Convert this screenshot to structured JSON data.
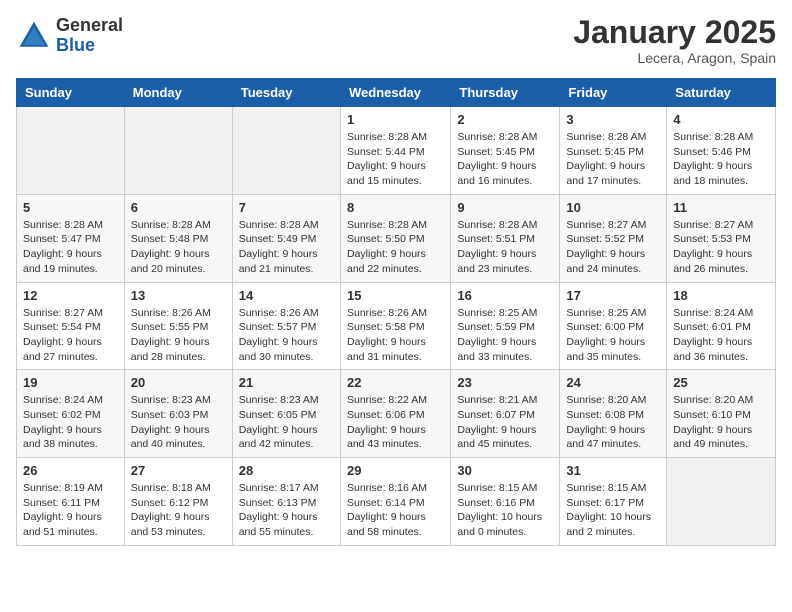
{
  "logo": {
    "general": "General",
    "blue": "Blue"
  },
  "header": {
    "month": "January 2025",
    "location": "Lecera, Aragon, Spain"
  },
  "weekdays": [
    "Sunday",
    "Monday",
    "Tuesday",
    "Wednesday",
    "Thursday",
    "Friday",
    "Saturday"
  ],
  "weeks": [
    [
      {
        "day": "",
        "info": ""
      },
      {
        "day": "",
        "info": ""
      },
      {
        "day": "",
        "info": ""
      },
      {
        "day": "1",
        "info": "Sunrise: 8:28 AM\nSunset: 5:44 PM\nDaylight: 9 hours\nand 15 minutes."
      },
      {
        "day": "2",
        "info": "Sunrise: 8:28 AM\nSunset: 5:45 PM\nDaylight: 9 hours\nand 16 minutes."
      },
      {
        "day": "3",
        "info": "Sunrise: 8:28 AM\nSunset: 5:45 PM\nDaylight: 9 hours\nand 17 minutes."
      },
      {
        "day": "4",
        "info": "Sunrise: 8:28 AM\nSunset: 5:46 PM\nDaylight: 9 hours\nand 18 minutes."
      }
    ],
    [
      {
        "day": "5",
        "info": "Sunrise: 8:28 AM\nSunset: 5:47 PM\nDaylight: 9 hours\nand 19 minutes."
      },
      {
        "day": "6",
        "info": "Sunrise: 8:28 AM\nSunset: 5:48 PM\nDaylight: 9 hours\nand 20 minutes."
      },
      {
        "day": "7",
        "info": "Sunrise: 8:28 AM\nSunset: 5:49 PM\nDaylight: 9 hours\nand 21 minutes."
      },
      {
        "day": "8",
        "info": "Sunrise: 8:28 AM\nSunset: 5:50 PM\nDaylight: 9 hours\nand 22 minutes."
      },
      {
        "day": "9",
        "info": "Sunrise: 8:28 AM\nSunset: 5:51 PM\nDaylight: 9 hours\nand 23 minutes."
      },
      {
        "day": "10",
        "info": "Sunrise: 8:27 AM\nSunset: 5:52 PM\nDaylight: 9 hours\nand 24 minutes."
      },
      {
        "day": "11",
        "info": "Sunrise: 8:27 AM\nSunset: 5:53 PM\nDaylight: 9 hours\nand 26 minutes."
      }
    ],
    [
      {
        "day": "12",
        "info": "Sunrise: 8:27 AM\nSunset: 5:54 PM\nDaylight: 9 hours\nand 27 minutes."
      },
      {
        "day": "13",
        "info": "Sunrise: 8:26 AM\nSunset: 5:55 PM\nDaylight: 9 hours\nand 28 minutes."
      },
      {
        "day": "14",
        "info": "Sunrise: 8:26 AM\nSunset: 5:57 PM\nDaylight: 9 hours\nand 30 minutes."
      },
      {
        "day": "15",
        "info": "Sunrise: 8:26 AM\nSunset: 5:58 PM\nDaylight: 9 hours\nand 31 minutes."
      },
      {
        "day": "16",
        "info": "Sunrise: 8:25 AM\nSunset: 5:59 PM\nDaylight: 9 hours\nand 33 minutes."
      },
      {
        "day": "17",
        "info": "Sunrise: 8:25 AM\nSunset: 6:00 PM\nDaylight: 9 hours\nand 35 minutes."
      },
      {
        "day": "18",
        "info": "Sunrise: 8:24 AM\nSunset: 6:01 PM\nDaylight: 9 hours\nand 36 minutes."
      }
    ],
    [
      {
        "day": "19",
        "info": "Sunrise: 8:24 AM\nSunset: 6:02 PM\nDaylight: 9 hours\nand 38 minutes."
      },
      {
        "day": "20",
        "info": "Sunrise: 8:23 AM\nSunset: 6:03 PM\nDaylight: 9 hours\nand 40 minutes."
      },
      {
        "day": "21",
        "info": "Sunrise: 8:23 AM\nSunset: 6:05 PM\nDaylight: 9 hours\nand 42 minutes."
      },
      {
        "day": "22",
        "info": "Sunrise: 8:22 AM\nSunset: 6:06 PM\nDaylight: 9 hours\nand 43 minutes."
      },
      {
        "day": "23",
        "info": "Sunrise: 8:21 AM\nSunset: 6:07 PM\nDaylight: 9 hours\nand 45 minutes."
      },
      {
        "day": "24",
        "info": "Sunrise: 8:20 AM\nSunset: 6:08 PM\nDaylight: 9 hours\nand 47 minutes."
      },
      {
        "day": "25",
        "info": "Sunrise: 8:20 AM\nSunset: 6:10 PM\nDaylight: 9 hours\nand 49 minutes."
      }
    ],
    [
      {
        "day": "26",
        "info": "Sunrise: 8:19 AM\nSunset: 6:11 PM\nDaylight: 9 hours\nand 51 minutes."
      },
      {
        "day": "27",
        "info": "Sunrise: 8:18 AM\nSunset: 6:12 PM\nDaylight: 9 hours\nand 53 minutes."
      },
      {
        "day": "28",
        "info": "Sunrise: 8:17 AM\nSunset: 6:13 PM\nDaylight: 9 hours\nand 55 minutes."
      },
      {
        "day": "29",
        "info": "Sunrise: 8:16 AM\nSunset: 6:14 PM\nDaylight: 9 hours\nand 58 minutes."
      },
      {
        "day": "30",
        "info": "Sunrise: 8:15 AM\nSunset: 6:16 PM\nDaylight: 10 hours\nand 0 minutes."
      },
      {
        "day": "31",
        "info": "Sunrise: 8:15 AM\nSunset: 6:17 PM\nDaylight: 10 hours\nand 2 minutes."
      },
      {
        "day": "",
        "info": ""
      }
    ]
  ]
}
